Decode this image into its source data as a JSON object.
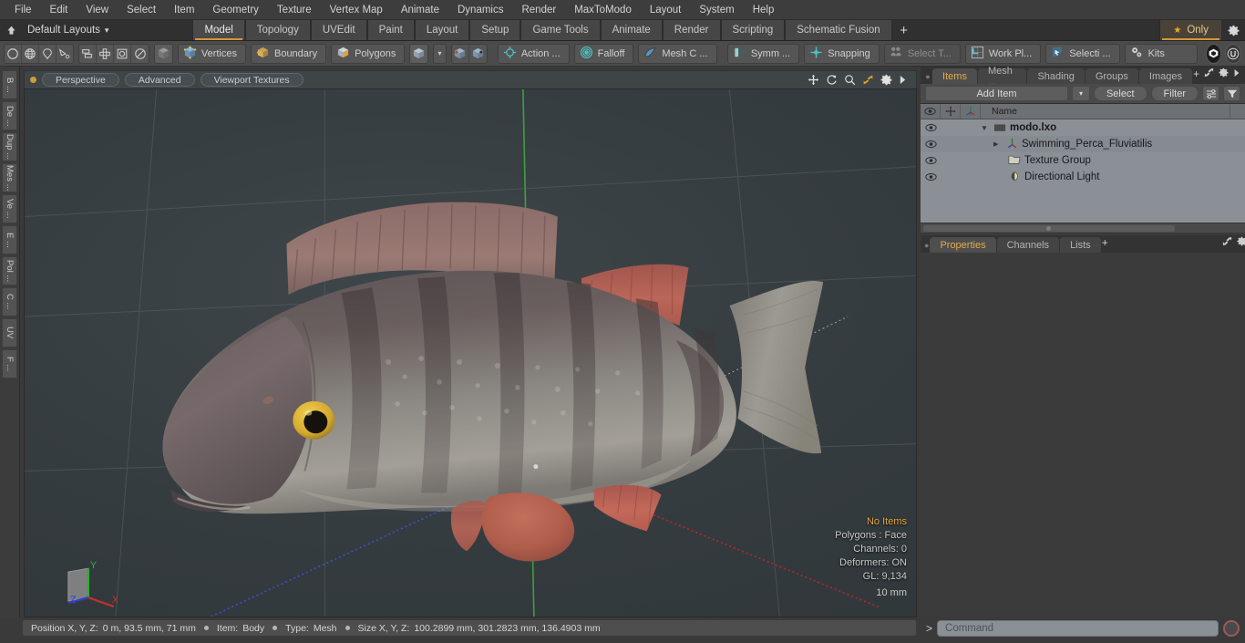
{
  "menu": {
    "items": [
      "File",
      "Edit",
      "View",
      "Select",
      "Item",
      "Geometry",
      "Texture",
      "Vertex Map",
      "Animate",
      "Dynamics",
      "Render",
      "MaxToModo",
      "Layout",
      "System",
      "Help"
    ]
  },
  "layoutbar": {
    "home_icon": "home-icon",
    "default_layouts": "Default Layouts",
    "caret": "▾",
    "tabs": [
      {
        "label": "Model",
        "active": true
      },
      {
        "label": "Topology",
        "active": false
      },
      {
        "label": "UVEdit",
        "active": false
      },
      {
        "label": "Paint",
        "active": false
      },
      {
        "label": "Layout",
        "active": false
      },
      {
        "label": "Setup",
        "active": false
      },
      {
        "label": "Game Tools",
        "active": false
      },
      {
        "label": "Animate",
        "active": false
      },
      {
        "label": "Render",
        "active": false
      },
      {
        "label": "Scripting",
        "active": false
      },
      {
        "label": "Schematic Fusion",
        "active": false
      }
    ],
    "add_tab": "+",
    "only_label": "Only",
    "only_star": "★",
    "gear_icon": "gear-icon"
  },
  "toolbar": {
    "group1": [
      "circle-select-icon",
      "globe-select-icon",
      "lasso-select-icon",
      "paint-select-icon"
    ],
    "group2": [
      "element-move-icon",
      "element-rotate-icon",
      "element-scale-icon",
      "element-transform-icon"
    ],
    "group3": [
      "item-mode-icon"
    ],
    "modes": [
      {
        "label": "Vertices",
        "icon": "vertices-icon"
      },
      {
        "label": "Boundary",
        "icon": "boundary-icon"
      },
      {
        "label": "Polygons",
        "icon": "polygons-icon"
      }
    ],
    "cube_icon": "cube-icon",
    "caret": "▾",
    "snap_icons": [
      "center-snap-icon",
      "axis-snap-icon"
    ],
    "tools": [
      {
        "label": "Action   ...",
        "icon": "action-center-icon",
        "dim": false
      },
      {
        "label": "Falloff",
        "icon": "falloff-icon",
        "dim": false
      },
      {
        "label": "Mesh C ...",
        "icon": "mesh-constraint-icon",
        "dim": false
      },
      {
        "label": "Symm ...",
        "icon": "symmetry-icon",
        "dim": false
      },
      {
        "label": "Snapping",
        "icon": "snapping-icon",
        "dim": false
      },
      {
        "label": "Select T...",
        "icon": "select-through-icon",
        "dim": true
      },
      {
        "label": "Work Pl...",
        "icon": "work-plane-icon",
        "dim": false
      },
      {
        "label": "Selecti  ...",
        "icon": "selection-set-icon",
        "dim": false
      }
    ],
    "kits": {
      "label": "Kits",
      "icon": "kits-gears-icon"
    },
    "right_icons": [
      "modo-badge-icon",
      "unreal-badge-icon"
    ]
  },
  "left_tabs": [
    "B ...",
    "De ...",
    "Dup ...",
    "Mes ...",
    "Ve ...",
    "E ...",
    "Pol ...",
    "C ...",
    "UV",
    "F ..."
  ],
  "viewport": {
    "dot_color": "#d09a3a",
    "pills": [
      "Perspective",
      "Advanced",
      "Viewport Textures"
    ],
    "header_icons": [
      "pan-icon",
      "rotate-icon",
      "zoom-icon",
      "fit-icon",
      "viewport-gear-icon",
      "viewport-arrow-icon"
    ],
    "axis_gizmo": {
      "x": "X",
      "y": "Y",
      "z": "Z",
      "x_color": "#c03030",
      "y_color": "#30b030",
      "z_color": "#3040c8"
    },
    "info": {
      "no_items": "No Items",
      "polygons": "Polygons : Face",
      "channels": "Channels: 0",
      "deformers": "Deformers: ON",
      "gl": "GL: 9,134",
      "scale": "10 mm"
    },
    "model_name": "Swimming Perca Fluviatilis (European perch)"
  },
  "right_panel": {
    "tabs": [
      {
        "label": "Items",
        "active": true
      },
      {
        "label": "Mesh ...",
        "active": false
      },
      {
        "label": "Shading",
        "active": false
      },
      {
        "label": "Groups",
        "active": false
      },
      {
        "label": "Images",
        "active": false
      }
    ],
    "tab_add": "+",
    "tab_tools": [
      "expand-icon",
      "panel-gear-icon",
      "panel-arrow-icon"
    ],
    "add_item": "Add Item",
    "add_item_caret": "▾",
    "select": "Select",
    "filter": "Filter",
    "list_icon": "list-options-icon",
    "funnel_icon": "funnel-icon",
    "tree_header": {
      "eye": "eye-icon",
      "lock": "transform-icon",
      "shade": "shading-icon",
      "name": "Name"
    },
    "tree": [
      {
        "label": "modo.lxo",
        "icon": "scene-icon",
        "level": 0,
        "bold": true,
        "expander": "▼"
      },
      {
        "label": "Swimming_Perca_Fluviatilis",
        "icon": "mesh-icon",
        "level": 1,
        "bold": false,
        "expander": "▶"
      },
      {
        "label": "Texture Group",
        "icon": "folder-icon",
        "level": 1,
        "bold": false,
        "expander": ""
      },
      {
        "label": "Directional Light",
        "icon": "light-icon",
        "level": 1,
        "bold": false,
        "expander": ""
      }
    ],
    "bottom_tabs": [
      {
        "label": "Properties",
        "active": true
      },
      {
        "label": "Channels",
        "active": false
      },
      {
        "label": "Lists",
        "active": false
      }
    ],
    "bottom_tab_add": "+"
  },
  "status": {
    "position_label": "Position X, Y, Z:",
    "position_value": "0 m, 93.5 mm, 71 mm",
    "item_label": "Item:",
    "item_value": "Body",
    "type_label": "Type:",
    "type_value": "Mesh",
    "size_label": "Size X, Y, Z:",
    "size_value": "100.2899 mm, 301.2823 mm, 136.4903 mm"
  },
  "command": {
    "prompt": ">",
    "placeholder": "Command",
    "value": "",
    "record_icon": "record-icon"
  },
  "colors": {
    "accent": "#d79636",
    "tab_text_active": "#e7a94a",
    "toolbar_bg": "#4b4b4b",
    "tree_bg": "#8b9096",
    "viewport_bg": "#353c40"
  }
}
